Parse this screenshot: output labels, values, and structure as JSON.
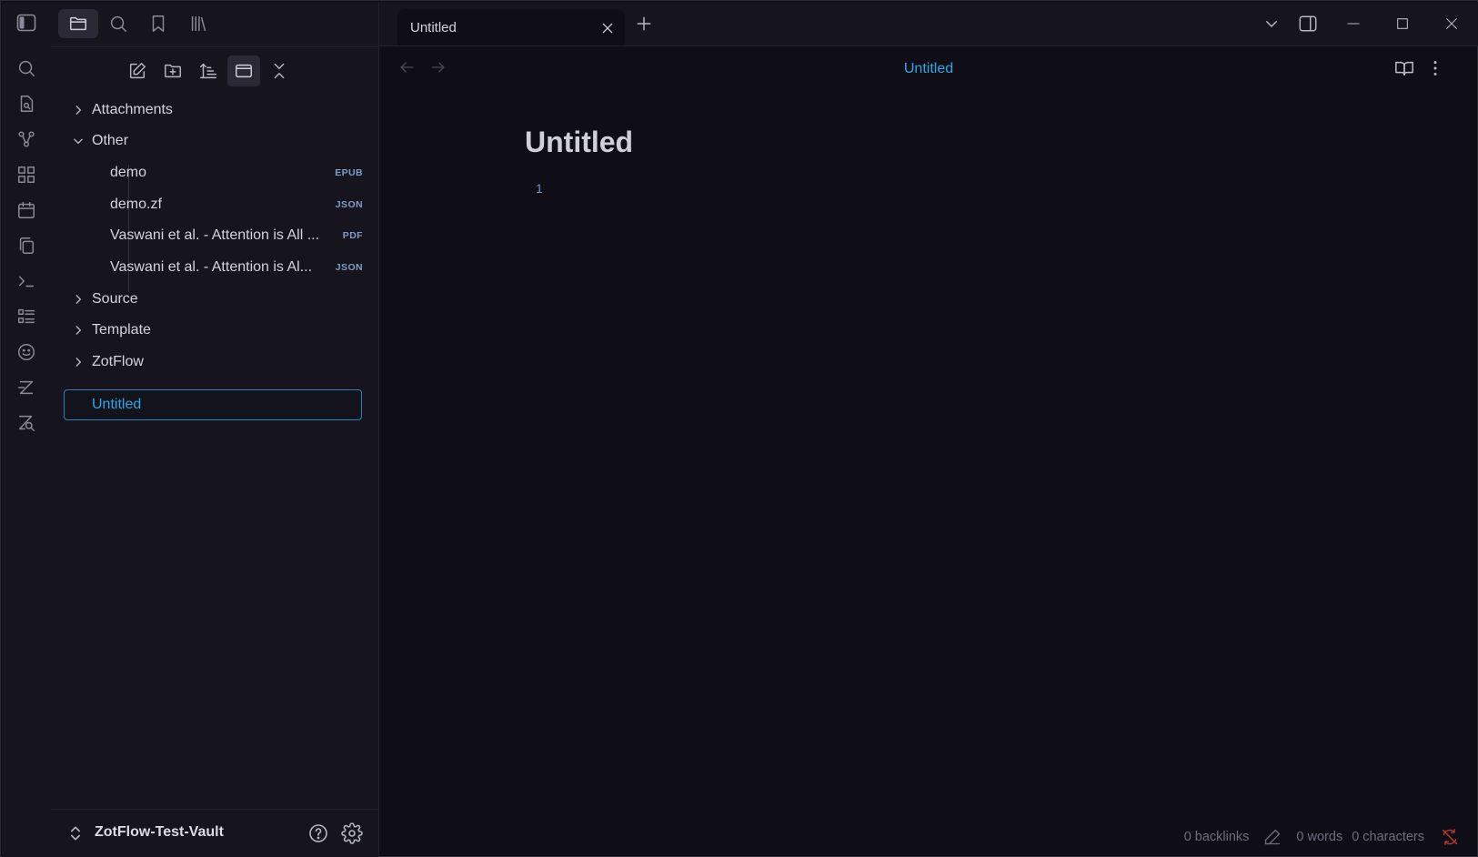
{
  "ribbon": {
    "icons": [
      "search-icon",
      "file-search-icon",
      "graph-icon",
      "grid-icon",
      "calendar-icon",
      "copy-icon",
      "terminal-icon",
      "list-icon",
      "smiley-icon",
      "zotero-icon",
      "zotero-search-icon"
    ]
  },
  "left_tabs": [
    "files",
    "search",
    "bookmarks",
    "library"
  ],
  "file_tree": {
    "items": [
      {
        "type": "folder",
        "label": "Attachments",
        "expanded": false
      },
      {
        "type": "folder",
        "label": "Other",
        "expanded": true
      },
      {
        "type": "file",
        "label": "demo",
        "ext": "EPUB"
      },
      {
        "type": "file",
        "label": "demo.zf",
        "ext": "JSON"
      },
      {
        "type": "file",
        "label": "Vaswani et al. - Attention is All ...",
        "ext": "PDF"
      },
      {
        "type": "file",
        "label": "Vaswani et al. - Attention is Al...",
        "ext": "JSON"
      },
      {
        "type": "folder",
        "label": "Source",
        "expanded": false
      },
      {
        "type": "folder",
        "label": "Template",
        "expanded": false
      },
      {
        "type": "folder",
        "label": "ZotFlow",
        "expanded": false
      },
      {
        "type": "note",
        "label": "Untitled",
        "selected": true
      }
    ]
  },
  "vault": {
    "name": "ZotFlow-Test-Vault"
  },
  "tab": {
    "title": "Untitled"
  },
  "view": {
    "title": "Untitled"
  },
  "note": {
    "title": "Untitled",
    "line_number": "1"
  },
  "status": {
    "backlinks": "0 backlinks",
    "words": "0 words",
    "characters": "0 characters"
  },
  "colors": {
    "accent": "#2fa5e8",
    "background": "#0f0e17",
    "sidebar": "#16151e",
    "sync_error": "#c0392b"
  }
}
